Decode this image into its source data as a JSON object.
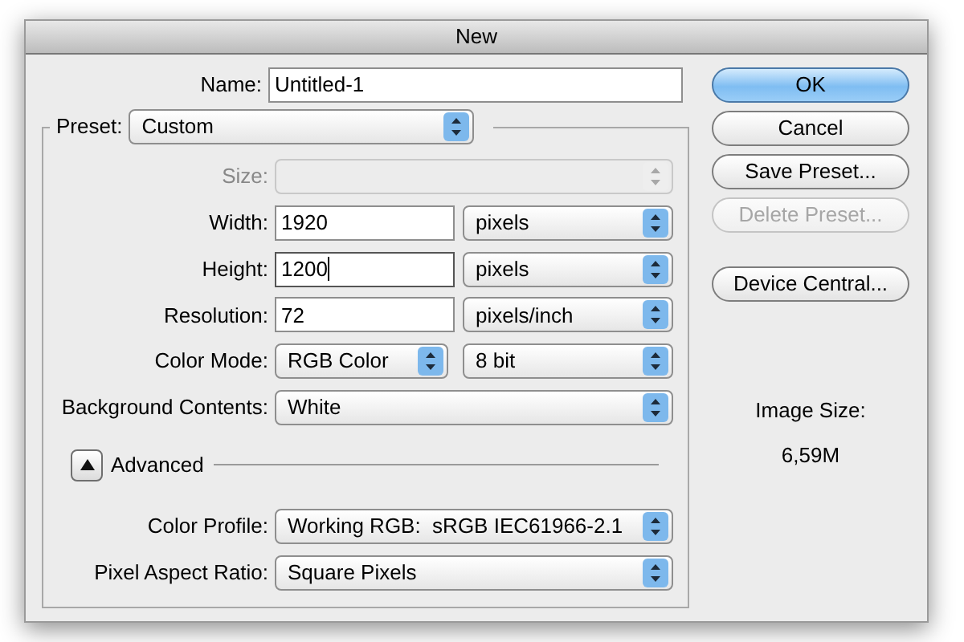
{
  "window": {
    "title": "New"
  },
  "name": {
    "label": "Name:",
    "value": "Untitled-1"
  },
  "preset": {
    "label": "Preset:",
    "value": "Custom"
  },
  "fields": [
    {
      "kind": "select",
      "label": "Size:",
      "disabled": true
    },
    {
      "kind": "input_select",
      "label": "Width:",
      "value": "1920",
      "unit": "pixels",
      "focused": false,
      "disabled": false
    },
    {
      "kind": "input_select",
      "label": "Height:",
      "value": "1200",
      "unit": "pixels",
      "focused": true,
      "disabled": false
    },
    {
      "kind": "input_select",
      "label": "Resolution:",
      "value": "72",
      "unit": "pixels/inch",
      "focused": false,
      "disabled": false
    },
    {
      "kind": "select_pair",
      "label": "Color Mode:",
      "value": "RGB Color",
      "unit": "8 bit",
      "disabled": false
    },
    {
      "kind": "select",
      "label": "Background Contents:",
      "value": "White",
      "disabled": false
    }
  ],
  "advanced": {
    "label": "Advanced",
    "expanded": true,
    "fields": [
      {
        "label": "Color Profile:",
        "value": "Working RGB:  sRGB IEC61966-2.1"
      },
      {
        "label": "Pixel Aspect Ratio:",
        "value": "Square Pixels"
      }
    ]
  },
  "buttons": [
    {
      "label": "OK",
      "default": true,
      "disabled": false
    },
    {
      "label": "Cancel",
      "default": false,
      "disabled": false
    },
    {
      "label": "Save Preset...",
      "default": false,
      "disabled": false
    },
    {
      "label": "Delete Preset...",
      "default": false,
      "disabled": true
    }
  ],
  "extra_button": {
    "label": "Device Central..."
  },
  "image_size": {
    "label": "Image Size:",
    "value": "6,59M"
  }
}
